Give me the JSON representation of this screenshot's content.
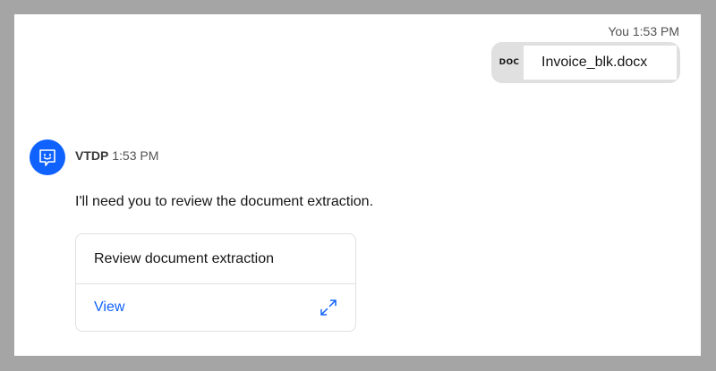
{
  "user_message": {
    "sender": "You",
    "time": "1:53 PM",
    "attachment": {
      "type_label": "DOC",
      "file_name": "Invoice_blk.docx"
    }
  },
  "bot_message": {
    "sender": "VTDP",
    "time": "1:53 PM",
    "text": "I'll need you to review the document extraction.",
    "card": {
      "title": "Review document extraction",
      "action_label": "View",
      "action_icon": "expand-icon"
    }
  },
  "colors": {
    "accent": "#0f62fe",
    "frame": "#a5a5a5",
    "chip_background": "#e0e0e0"
  }
}
